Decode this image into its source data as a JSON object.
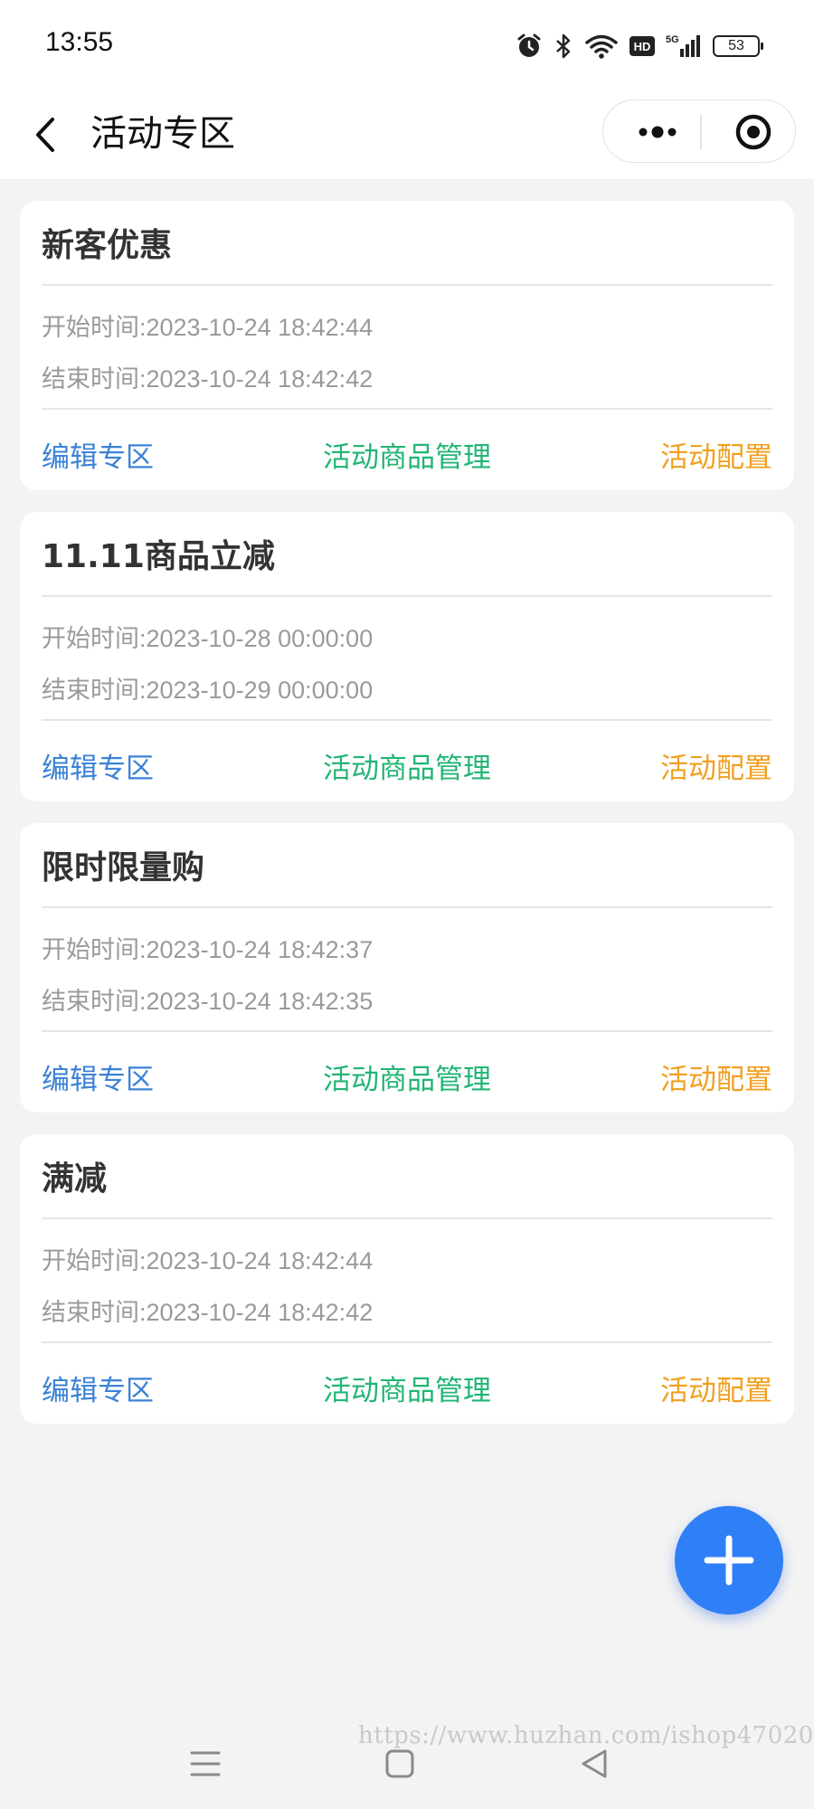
{
  "status_bar": {
    "time": "13:55",
    "battery": "53",
    "icons": [
      "alarm-icon",
      "bluetooth-icon",
      "wifi-icon",
      "hd-icon",
      "signal-5g-icon",
      "battery-icon"
    ]
  },
  "nav": {
    "title": "活动专区",
    "back_icon": "chevron-left-icon",
    "more_icon": "more-dots-icon",
    "close_icon": "target-circle-icon"
  },
  "cards": [
    {
      "title": "新客优惠",
      "start": "开始时间:2023-10-24 18:42:44",
      "end": "结束时间:2023-10-24 18:42:42",
      "edit": "编辑专区",
      "goods": "活动商品管理",
      "config": "活动配置"
    },
    {
      "title": "11.11商品立减",
      "start": "开始时间:2023-10-28 00:00:00",
      "end": "结束时间:2023-10-29 00:00:00",
      "edit": "编辑专区",
      "goods": "活动商品管理",
      "config": "活动配置"
    },
    {
      "title": "限时限量购",
      "start": "开始时间:2023-10-24 18:42:37",
      "end": "结束时间:2023-10-24 18:42:35",
      "edit": "编辑专区",
      "goods": "活动商品管理",
      "config": "活动配置"
    },
    {
      "title": "满减",
      "start": "开始时间:2023-10-24 18:42:44",
      "end": "结束时间:2023-10-24 18:42:42",
      "edit": "编辑专区",
      "goods": "活动商品管理",
      "config": "活动配置"
    }
  ],
  "colors": {
    "edit": "#3b82d6",
    "goods": "#22b573",
    "config": "#f0a020",
    "fab": "#2f7ff7",
    "background": "#f3f3f3"
  },
  "fab_icon": "plus-icon",
  "system_nav": [
    "menu-icon",
    "home-square-icon",
    "back-triangle-icon"
  ],
  "watermark": "https://www.huzhan.com/ishop47020"
}
